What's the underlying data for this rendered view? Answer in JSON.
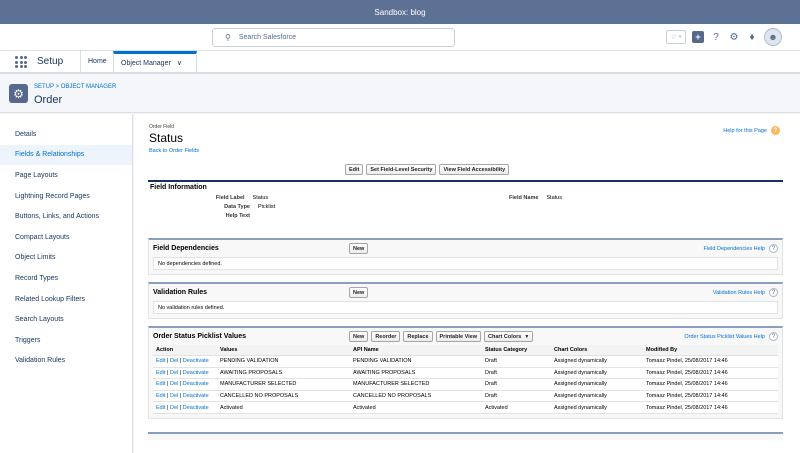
{
  "sandbox_banner": "Sandbox: blog",
  "header": {
    "search_placeholder": "Search Salesforce"
  },
  "nav": {
    "app_name": "Setup",
    "home_tab": "Home",
    "object_manager_tab": "Object Manager"
  },
  "object": {
    "breadcrumb": "SETUP > OBJECT MANAGER",
    "title": "Order"
  },
  "sidebar": {
    "items": [
      {
        "label": "Details"
      },
      {
        "label": "Fields & Relationships"
      },
      {
        "label": "Page Layouts"
      },
      {
        "label": "Lightning Record Pages"
      },
      {
        "label": "Buttons, Links, and Actions"
      },
      {
        "label": "Compact Layouts"
      },
      {
        "label": "Object Limits"
      },
      {
        "label": "Record Types"
      },
      {
        "label": "Related Lookup Filters"
      },
      {
        "label": "Search Layouts"
      },
      {
        "label": "Triggers"
      },
      {
        "label": "Validation Rules"
      }
    ],
    "active_index": 1
  },
  "field": {
    "type_label": "Order Field",
    "title": "Status",
    "back_link": "Back to Order Fields",
    "help_link": "Help for this Page",
    "buttons": {
      "edit": "Edit",
      "fls": "Set Field-Level Security",
      "accessibility": "View Field Accessibility"
    },
    "info": {
      "section_title": "Field Information",
      "field_label_label": "Field Label",
      "field_label_value": "Status",
      "data_type_label": "Data Type",
      "data_type_value": "Picklist",
      "help_text_label": "Help Text",
      "help_text_value": "",
      "field_name_label": "Field Name",
      "field_name_value": "Status"
    }
  },
  "dependencies": {
    "title": "Field Dependencies",
    "new_button": "New",
    "help": "Field Dependencies Help",
    "empty": "No dependencies defined."
  },
  "validation": {
    "title": "Validation Rules",
    "new_button": "New",
    "help": "Validation Rules Help",
    "empty": "No validation rules defined."
  },
  "picklist": {
    "title": "Order Status Picklist Values",
    "buttons": {
      "new": "New",
      "reorder": "Reorder",
      "replace": "Replace",
      "printable": "Printable View",
      "chart_colors": "Chart Colors"
    },
    "help": "Order Status Picklist Values Help",
    "columns": {
      "action": "Action",
      "values": "Values",
      "api_name": "API Name",
      "status_category": "Status Category",
      "chart_colors": "Chart Colors",
      "modified_by": "Modified By"
    },
    "action_labels": {
      "edit": "Edit",
      "del": "Del",
      "deactivate": "Deactivate",
      "sep": "|"
    },
    "rows": [
      {
        "value": "PENDING VALIDATION",
        "api": "PENDING VALIDATION",
        "category": "Draft",
        "colors": "Assigned dynamically",
        "user": "Tomasz Pindel",
        "date": ", 25/08/2017 14:46"
      },
      {
        "value": "AWAITING PROPOSALS",
        "api": "AWAITING PROPOSALS",
        "category": "Draft",
        "colors": "Assigned dynamically",
        "user": "Tomasz Pindel",
        "date": ", 25/08/2017 14:46"
      },
      {
        "value": "MANUFACTURER SELECTED",
        "api": "MANUFACTURER SELECTED",
        "category": "Draft",
        "colors": "Assigned dynamically",
        "user": "Tomasz Pindel",
        "date": ", 25/08/2017 14:46"
      },
      {
        "value": "CANCELLED NO PROPOSALS",
        "api": "CANCELLED NO PROPOSALS",
        "category": "Draft",
        "colors": "Assigned dynamically",
        "user": "Tomasz Pindel",
        "date": ", 25/08/2017 14:46"
      },
      {
        "value": "Activated",
        "api": "Activated",
        "category": "Activated",
        "colors": "Assigned dynamically",
        "user": "Tomasz Pindel",
        "date": ", 25/08/2017 14:46"
      }
    ]
  },
  "icons": {
    "search": "search-icon",
    "favorites": "star-icon",
    "add": "plus-icon",
    "help": "question-icon",
    "setup": "gear-icon",
    "notifications": "bell-icon",
    "object": "gear-icon"
  }
}
